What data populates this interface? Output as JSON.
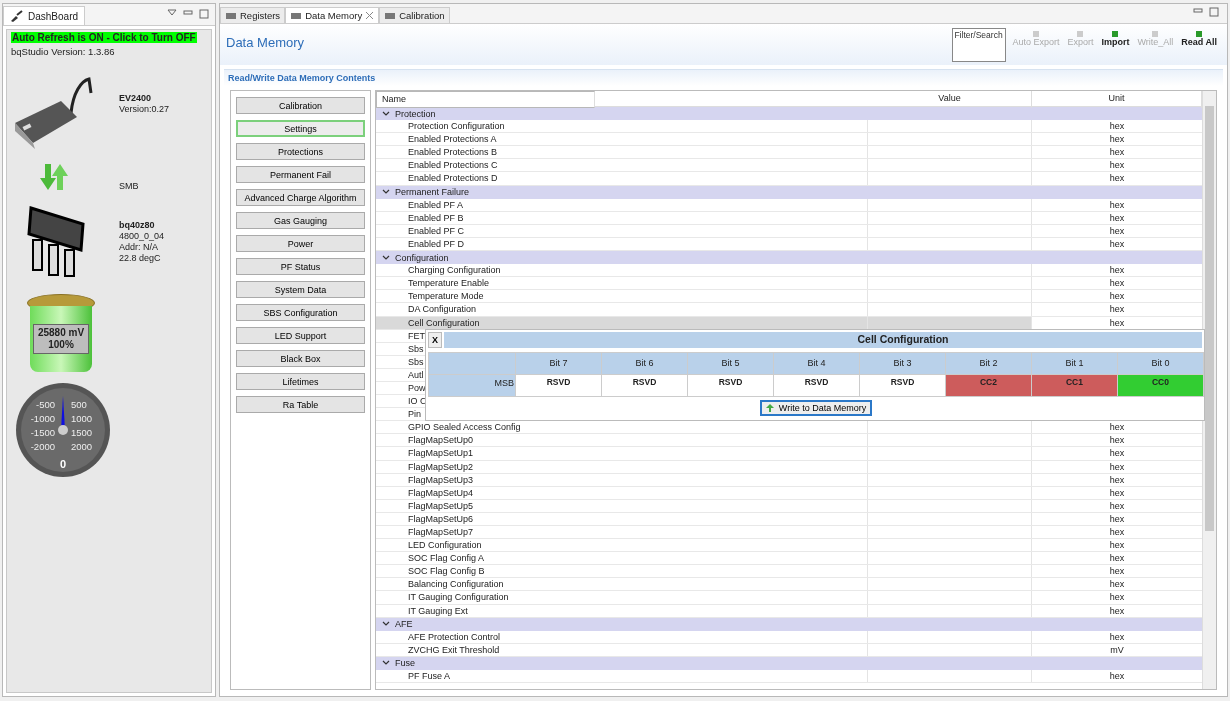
{
  "dashboard": {
    "tab": "DashBoard",
    "auto_refresh": {
      "label": "Auto Refresh is ON - Click to Turn OFF",
      "on": true
    },
    "version": "bqStudio Version:  1.3.86",
    "adapter": {
      "name": "EV2400",
      "detail": "Version:0.27"
    },
    "bus": "SMB",
    "device": {
      "name": "bq40z80",
      "lines": [
        "4800_0_04",
        "Addr: N/A",
        "22.8 degC"
      ]
    },
    "battery": {
      "voltage": "25880 mV",
      "percent": "100%"
    },
    "gauge": {
      "left_labels": [
        "-500",
        "-1000",
        "-1500",
        "-2000"
      ],
      "right_labels": [
        "500",
        "1000",
        "1500",
        "2000"
      ],
      "value": "0"
    }
  },
  "tabs": [
    {
      "label": "Registers",
      "selected": false
    },
    {
      "label": "Data Memory",
      "selected": true
    },
    {
      "label": "Calibration",
      "selected": false
    }
  ],
  "title": "Data Memory",
  "toolbar": {
    "search": {
      "placeholder": "Filter/Search"
    },
    "buttons": [
      {
        "label": "Auto Export",
        "disabled": true
      },
      {
        "label": "Export",
        "disabled": true
      },
      {
        "label": "Import",
        "disabled": false
      },
      {
        "label": "Write_All",
        "disabled": true
      },
      {
        "label": "Read All",
        "disabled": false
      }
    ]
  },
  "section": "Read/Write Data Memory Contents",
  "categories": [
    {
      "label": "Calibration",
      "selected": false
    },
    {
      "label": "Settings",
      "selected": true
    },
    {
      "label": "Protections",
      "selected": false
    },
    {
      "label": "Permanent Fail",
      "selected": false
    },
    {
      "label": "Advanced Charge Algorithm",
      "selected": false
    },
    {
      "label": "Gas Gauging",
      "selected": false
    },
    {
      "label": "Power",
      "selected": false
    },
    {
      "label": "PF Status",
      "selected": false
    },
    {
      "label": "System Data",
      "selected": false
    },
    {
      "label": "SBS Configuration",
      "selected": false
    },
    {
      "label": "LED Support",
      "selected": false
    },
    {
      "label": "Black Box",
      "selected": false
    },
    {
      "label": "Lifetimes",
      "selected": false
    },
    {
      "label": "Ra Table",
      "selected": false
    }
  ],
  "table": {
    "columns": [
      "Name",
      "Value",
      "Unit"
    ],
    "groups": [
      {
        "name": "Protection",
        "expanded": true,
        "children": [
          {
            "name": "Protection Configuration",
            "unit": "hex",
            "selected": false
          },
          {
            "name": "Enabled Protections A",
            "unit": "hex",
            "selected": false
          },
          {
            "name": "Enabled Protections B",
            "unit": "hex",
            "selected": false
          },
          {
            "name": "Enabled Protections C",
            "unit": "hex",
            "selected": false
          },
          {
            "name": "Enabled Protections D",
            "unit": "hex",
            "selected": false
          }
        ]
      },
      {
        "name": "Permanent Failure",
        "expanded": true,
        "children": [
          {
            "name": "Enabled PF A",
            "unit": "hex",
            "selected": false
          },
          {
            "name": "Enabled PF B",
            "unit": "hex",
            "selected": false
          },
          {
            "name": "Enabled PF C",
            "unit": "hex",
            "selected": false
          },
          {
            "name": "Enabled PF D",
            "unit": "hex",
            "selected": false
          }
        ]
      },
      {
        "name": "Configuration",
        "expanded": true,
        "children": [
          {
            "name": "Charging Configuration",
            "unit": "hex",
            "selected": false
          },
          {
            "name": "Temperature Enable",
            "unit": "hex",
            "selected": false
          },
          {
            "name": "Temperature Mode",
            "unit": "hex",
            "selected": false
          },
          {
            "name": "DA Configuration",
            "unit": "hex",
            "selected": false
          },
          {
            "name": "Cell Configuration",
            "unit": "hex",
            "selected": true
          },
          {
            "name": "FET",
            "selected": false
          },
          {
            "name": "Sbs",
            "selected": false
          },
          {
            "name": "Sbs",
            "selected": false
          },
          {
            "name": "Autl",
            "selected": false
          },
          {
            "name": "Pow",
            "selected": false
          },
          {
            "name": "IO C",
            "selected": false
          },
          {
            "name": "Pin",
            "selected": false
          },
          {
            "name": "GPIO Sealed Access Config",
            "unit": "hex",
            "selected": false
          },
          {
            "name": "FlagMapSetUp0",
            "unit": "hex",
            "selected": false
          },
          {
            "name": "FlagMapSetUp1",
            "unit": "hex",
            "selected": false
          },
          {
            "name": "FlagMapSetUp2",
            "unit": "hex",
            "selected": false
          },
          {
            "name": "FlagMapSetUp3",
            "unit": "hex",
            "selected": false
          },
          {
            "name": "FlagMapSetUp4",
            "unit": "hex",
            "selected": false
          },
          {
            "name": "FlagMapSetUp5",
            "unit": "hex",
            "selected": false
          },
          {
            "name": "FlagMapSetUp6",
            "unit": "hex",
            "selected": false
          },
          {
            "name": "FlagMapSetUp7",
            "unit": "hex",
            "selected": false
          },
          {
            "name": "LED Configuration",
            "unit": "hex",
            "selected": false
          },
          {
            "name": "SOC Flag Config A",
            "unit": "hex",
            "selected": false
          },
          {
            "name": "SOC Flag Config B",
            "unit": "hex",
            "selected": false
          },
          {
            "name": "Balancing Configuration",
            "unit": "hex",
            "selected": false
          },
          {
            "name": "IT Gauging Configuration",
            "unit": "hex",
            "selected": false
          },
          {
            "name": "IT Gauging Ext",
            "unit": "hex",
            "selected": false
          }
        ]
      },
      {
        "name": "AFE",
        "expanded": true,
        "children": [
          {
            "name": "AFE Protection Control",
            "unit": "hex",
            "selected": false
          },
          {
            "name": "ZVCHG Exit Threshold",
            "unit": "mV",
            "selected": false
          }
        ]
      },
      {
        "name": "Fuse",
        "expanded": true,
        "children": [
          {
            "name": "PF Fuse A",
            "unit": "hex",
            "selected": false
          }
        ]
      }
    ]
  },
  "popup": {
    "close": "X",
    "title": "Cell Configuration",
    "row_label": "MSB",
    "bits": [
      {
        "header": "Bit 7",
        "name": "RSVD",
        "color": "#ffffff"
      },
      {
        "header": "Bit 6",
        "name": "RSVD",
        "color": "#ffffff"
      },
      {
        "header": "Bit 5",
        "name": "RSVD",
        "color": "#ffffff"
      },
      {
        "header": "Bit 4",
        "name": "RSVD",
        "color": "#ffffff"
      },
      {
        "header": "Bit 3",
        "name": "RSVD",
        "color": "#ffffff"
      },
      {
        "header": "Bit 2",
        "name": "CC2",
        "color": "#cd5c5c"
      },
      {
        "header": "Bit 1",
        "name": "CC1",
        "color": "#cd5c5c"
      },
      {
        "header": "Bit 0",
        "name": "CC0",
        "color": "#32cd32"
      }
    ],
    "button": "Write to Data Memory"
  }
}
